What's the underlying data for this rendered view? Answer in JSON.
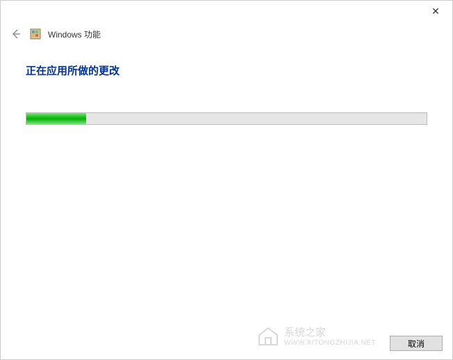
{
  "titlebar": {
    "close_glyph": "✕"
  },
  "header": {
    "back_glyph": "←",
    "window_title": "Windows 功能"
  },
  "content": {
    "heading": "正在应用所做的更改",
    "progress_percent": 15
  },
  "footer": {
    "cancel_label": "取消"
  },
  "watermark": {
    "line1": "系统之家",
    "line2": "WWW.XITONGZHIJIA.NET"
  }
}
